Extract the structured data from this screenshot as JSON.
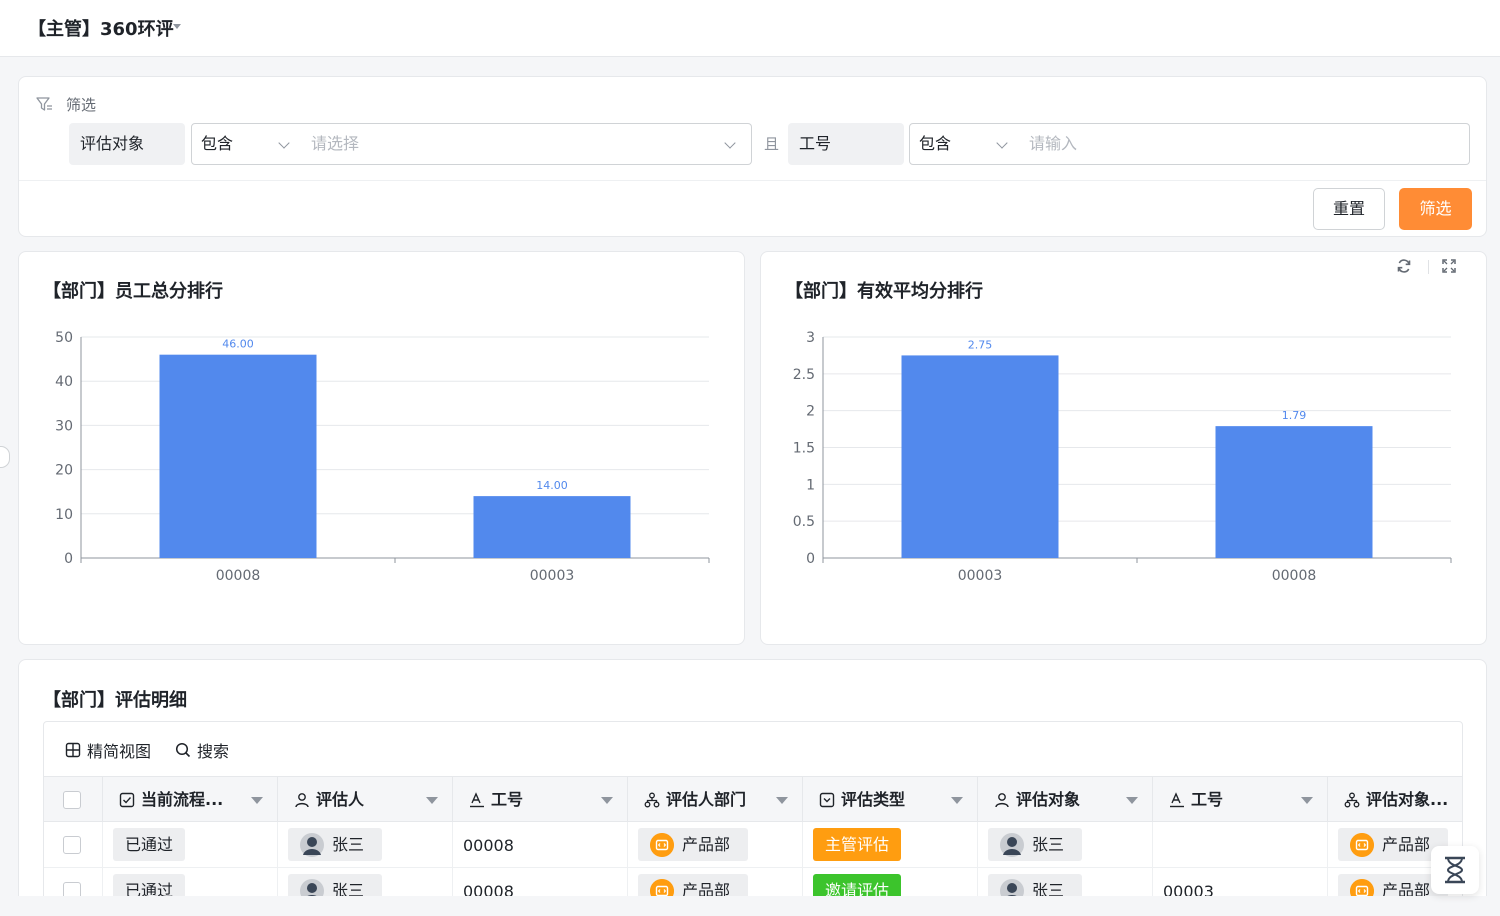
{
  "app": {
    "title": "【主管】360环评"
  },
  "filter": {
    "label": "筛选",
    "condition1": {
      "field": "评估对象",
      "operator": "包含",
      "placeholder": "请选择"
    },
    "connector": "且",
    "condition2": {
      "field": "工号",
      "operator": "包含",
      "placeholder": "请输入"
    },
    "reset_label": "重置",
    "apply_label": "筛选"
  },
  "colors": {
    "accent": "#ff8c35",
    "bar": "#5289ed",
    "tag_orange": "#ff9d10",
    "tag_green": "#3cc42c"
  },
  "charts": [
    {
      "title": "【部门】员工总分排行"
    },
    {
      "title": "【部门】有效平均分排行"
    }
  ],
  "chart_data": [
    {
      "type": "bar",
      "title": "【部门】员工总分排行",
      "categories": [
        "00008",
        "00003"
      ],
      "values": [
        46,
        14
      ],
      "data_labels": [
        "46.00",
        "14.00"
      ],
      "yticks": [
        "0",
        "10",
        "20",
        "30",
        "40",
        "50"
      ],
      "ylim": [
        0,
        50
      ],
      "grid": true
    },
    {
      "type": "bar",
      "title": "【部门】有效平均分排行",
      "categories": [
        "00003",
        "00008"
      ],
      "values": [
        2.75,
        1.79
      ],
      "data_labels": [
        "2.75",
        "1.79"
      ],
      "yticks": [
        "0",
        "0.5",
        "1",
        "1.5",
        "2",
        "2.5",
        "3"
      ],
      "ylim": [
        0,
        3
      ],
      "grid": true
    }
  ],
  "details": {
    "title": "【部门】评估明细",
    "toolbar": {
      "view_label": "精简视图",
      "search_label": "搜索"
    },
    "columns": [
      "当前流程...",
      "评估人",
      "工号",
      "评估人部门",
      "评估类型",
      "评估对象",
      "工号",
      "评估对象..."
    ],
    "rows": [
      {
        "status": "已通过",
        "evaluator": "张三",
        "id": "00008",
        "dept": "产品部",
        "type": "主管评估",
        "target": "张三",
        "target_id": "",
        "target_dept": "产品部"
      },
      {
        "status": "已通过",
        "evaluator": "张三",
        "id": "00008",
        "dept": "产品部",
        "type": "邀请评估",
        "target": "张三",
        "target_id": "00003",
        "target_dept": "产品部"
      }
    ]
  }
}
